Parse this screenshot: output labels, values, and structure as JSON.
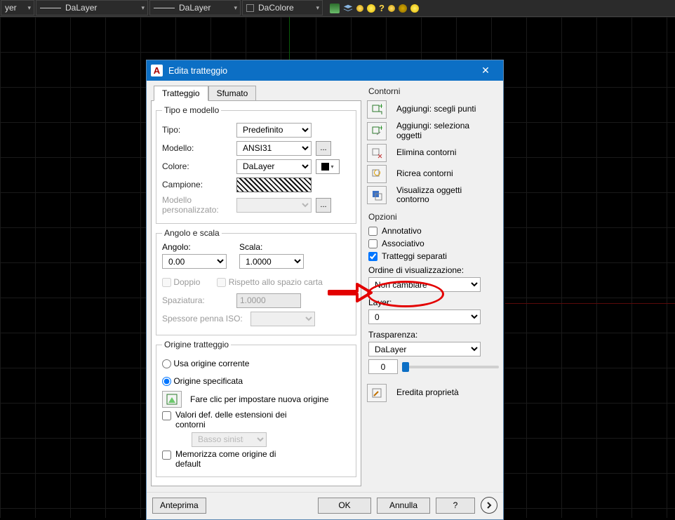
{
  "toolbar": {
    "combos": [
      {
        "text": "yer",
        "has_line": true
      },
      {
        "text": "DaLayer",
        "has_line": true
      },
      {
        "text": "DaLayer",
        "has_line": true
      },
      {
        "text": "DaColore",
        "has_sq": true
      }
    ]
  },
  "dialog": {
    "title": "Edita tratteggio",
    "tabs": {
      "tab1": "Tratteggio",
      "tab2": "Sfumato"
    },
    "tipo_modello": {
      "legend": "Tipo e modello",
      "tipo_label": "Tipo:",
      "tipo_value": "Predefinito",
      "modello_label": "Modello:",
      "modello_value": "ANSI31",
      "colore_label": "Colore:",
      "colore_value": "DaLayer",
      "campione_label": "Campione:",
      "custom_label": "Modello personalizzato:",
      "ellipsis": "..."
    },
    "angolo_scala": {
      "legend": "Angolo e scala",
      "angolo_label": "Angolo:",
      "angolo_value": "0.00",
      "scala_label": "Scala:",
      "scala_value": "1.0000",
      "doppio": "Doppio",
      "rispetto": "Rispetto allo spazio carta",
      "spaziatura_label": "Spaziatura:",
      "spaziatura_value": "1.0000",
      "iso_label": "Spessore penna ISO:"
    },
    "origine": {
      "legend": "Origine tratteggio",
      "usa_corrente": "Usa origine corrente",
      "specificata": "Origine specificata",
      "fare_clic": "Fare clic per impostare nuova origine",
      "valori_def": "Valori def. delle estensioni dei contorni",
      "basso_sinistra": "Basso sinistra",
      "memorizza": "Memorizza come origine di default"
    },
    "contorni": {
      "head": "Contorni",
      "aggiungi_punti": "Aggiungi: scegli punti",
      "aggiungi_oggetti": "Aggiungi: seleziona oggetti",
      "elimina": "Elimina contorni",
      "ricrea": "Ricrea contorni",
      "visualizza": "Visualizza oggetti contorno"
    },
    "opzioni": {
      "head": "Opzioni",
      "annotativo": "Annotativo",
      "associativo": "Associativo",
      "separati": "Tratteggi separati",
      "ordine_label": "Ordine di visualizzazione:",
      "ordine_value": "Non cambiare",
      "layer_label": "Layer:",
      "layer_value": "0",
      "trasparenza_label": "Trasparenza:",
      "trasparenza_value": "DaLayer",
      "trasparenza_num": "0"
    },
    "eredita": "Eredita proprietà",
    "footer": {
      "anteprima": "Anteprima",
      "ok": "OK",
      "annulla": "Annulla",
      "help": "?"
    }
  }
}
